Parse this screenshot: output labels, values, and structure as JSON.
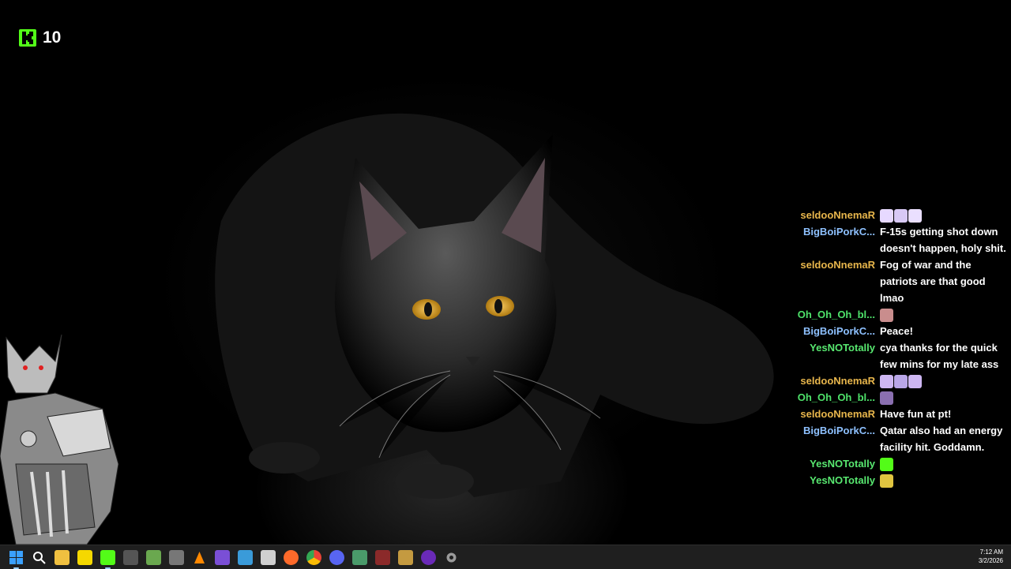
{
  "stream": {
    "viewer_count": "10",
    "viewer_icon": "kick-logo-icon"
  },
  "chat": {
    "messages": [
      {
        "user": "seldooNnemaR",
        "color": "#e8b64c",
        "text": "",
        "emotes": [
          "#e7d9ff",
          "#d8c9f5",
          "#eadfff"
        ]
      },
      {
        "user": "BigBoiPorkC...",
        "color": "#8ec1ff",
        "text": "F-15s getting shot down doesn't happen, holy shit.",
        "emotes": []
      },
      {
        "user": "seldooNnemaR",
        "color": "#e8b64c",
        "text": "Fog of war and the patriots are that good lmao",
        "emotes": []
      },
      {
        "user": "Oh_Oh_Oh_bl...",
        "color": "#4ee26a",
        "text": "",
        "emotes": [
          "#c98d8d"
        ]
      },
      {
        "user": "BigBoiPorkC...",
        "color": "#8ec1ff",
        "text": "Peace!",
        "emotes": []
      },
      {
        "user": "YesNOTotally",
        "color": "#58e870",
        "text": "cya thanks for the quick few mins for my late ass",
        "emotes": []
      },
      {
        "user": "seldooNnemaR",
        "color": "#e8b64c",
        "text": "",
        "emotes": [
          "#cdb6f2",
          "#b9a6e8",
          "#cdb6f2"
        ]
      },
      {
        "user": "Oh_Oh_Oh_bl...",
        "color": "#4ee26a",
        "text": "",
        "emotes": [
          "#8a6fb0"
        ]
      },
      {
        "user": "seldooNnemaR",
        "color": "#e8b64c",
        "text": "Have fun at pt!",
        "emotes": []
      },
      {
        "user": "BigBoiPorkC...",
        "color": "#8ec1ff",
        "text": "Qatar also had an energy facility hit. Goddamn.",
        "emotes": []
      },
      {
        "user": "YesNOTotally",
        "color": "#58e870",
        "text": "",
        "emotes": [
          "#53fc18"
        ]
      },
      {
        "user": "YesNOTotally",
        "color": "#58e870",
        "text": "",
        "emotes": [
          "#e0c440"
        ]
      }
    ]
  },
  "taskbar": {
    "icons": [
      {
        "name": "start-icon",
        "color": "#2f8cf0",
        "glyph": ""
      },
      {
        "name": "search-icon",
        "color": "transparent",
        "glyph": ""
      },
      {
        "name": "file-explorer-icon",
        "color": "#f0c040",
        "glyph": ""
      },
      {
        "name": "sticky-notes-icon",
        "color": "#f5d800",
        "glyph": ""
      },
      {
        "name": "kick-app-icon",
        "color": "#53fc18",
        "glyph": ""
      },
      {
        "name": "clock-app-icon",
        "color": "#555555",
        "glyph": ""
      },
      {
        "name": "layers-app-icon",
        "color": "#6aa84f",
        "glyph": ""
      },
      {
        "name": "timer-app-icon",
        "color": "#777777",
        "glyph": ""
      },
      {
        "name": "vlc-icon",
        "color": "#ff8800",
        "glyph": ""
      },
      {
        "name": "tools-app-icon",
        "color": "#7a4fd6",
        "glyph": ""
      },
      {
        "name": "wrench-app-icon",
        "color": "#3a9bd9",
        "glyph": ""
      },
      {
        "name": "document-app-icon",
        "color": "#d0d0d0",
        "glyph": ""
      },
      {
        "name": "firefox-icon",
        "color": "#ff6a2a",
        "glyph": ""
      },
      {
        "name": "chrome-icon",
        "color": "#34a853",
        "glyph": ""
      },
      {
        "name": "discord-icon",
        "color": "#5865f2",
        "glyph": ""
      },
      {
        "name": "browser-app-icon",
        "color": "#4a9a6a",
        "glyph": ""
      },
      {
        "name": "media-app-icon",
        "color": "#8b2a2a",
        "glyph": ""
      },
      {
        "name": "game-app-icon",
        "color": "#c49a40",
        "glyph": ""
      },
      {
        "name": "obs-icon",
        "color": "#6a2ab8",
        "glyph": ""
      },
      {
        "name": "settings-icon",
        "color": "#8a8a8a",
        "glyph": ""
      }
    ],
    "active": [
      0,
      4
    ],
    "time": "7:12 AM",
    "date": "3/2/2026"
  }
}
